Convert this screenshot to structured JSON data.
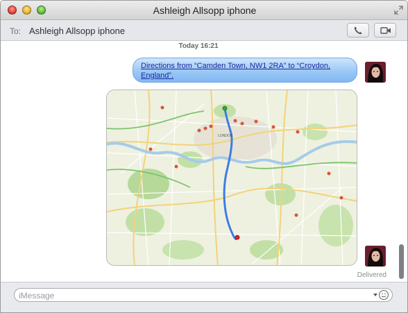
{
  "window": {
    "title": "Ashleigh Allsopp iphone"
  },
  "to_bar": {
    "label": "To:",
    "recipient": "Ashleigh Allsopp iphone"
  },
  "transcript": {
    "timestamp_day": "Today",
    "timestamp_time": "16:21",
    "message_text": "Directions from “Camden Town, NW1 2RA” to “Croydon, England”.",
    "map_label": "LONDON",
    "status": "Delivered"
  },
  "input": {
    "placeholder": "iMessage",
    "value": ""
  },
  "icons": {
    "close": "close-icon",
    "minimize": "minimize-icon",
    "zoom": "zoom-icon",
    "fullscreen": "fullscreen-icon",
    "phone": "phone-icon",
    "video": "video-camera-icon",
    "emoji": "emoji-icon"
  },
  "colors": {
    "bubble_blue": "#9bc8f6",
    "link": "#1a2a9a",
    "route": "#3d7be6"
  }
}
